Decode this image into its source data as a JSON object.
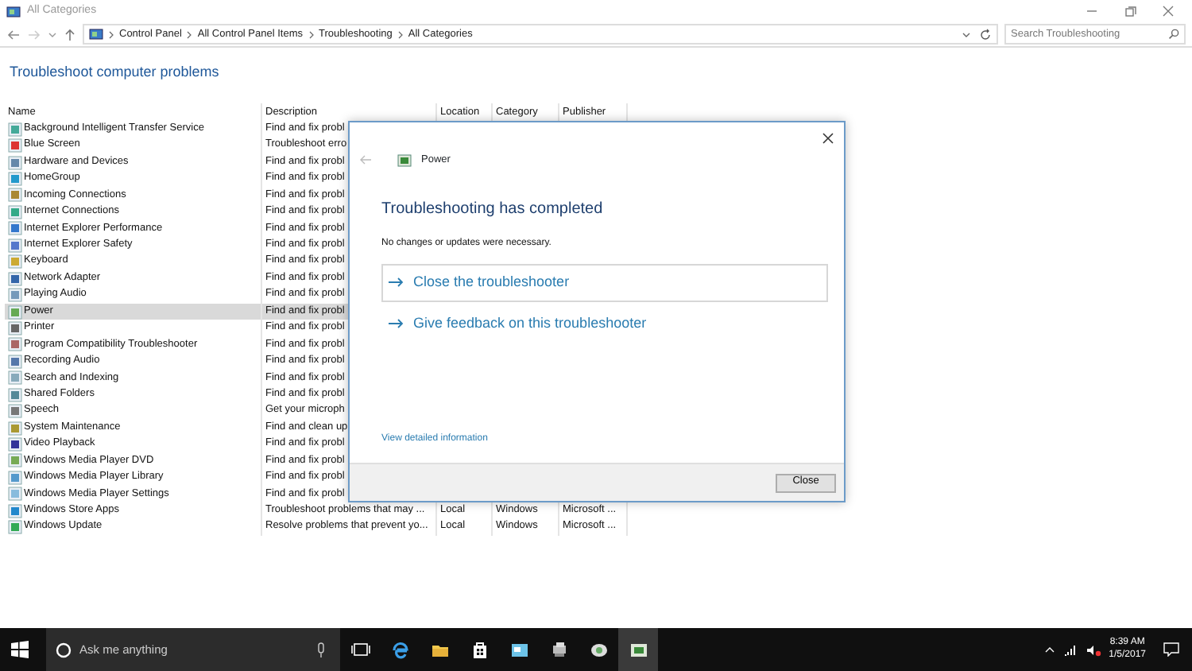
{
  "window": {
    "title": "All Categories"
  },
  "address_bar": {
    "breadcrumbs": [
      "Control Panel",
      "All Control Panel Items",
      "Troubleshooting",
      "All Categories"
    ],
    "search_placeholder": "Search Troubleshooting"
  },
  "heading": "Troubleshoot computer problems",
  "table": {
    "columns": [
      "Name",
      "Description",
      "Location",
      "Category",
      "Publisher"
    ],
    "rows": [
      {
        "name": "Background Intelligent Transfer Service",
        "description": "Find and fix probl",
        "selected": false
      },
      {
        "name": "Blue Screen",
        "description": "Troubleshoot erro",
        "selected": false
      },
      {
        "name": "Hardware and Devices",
        "description": "Find and fix probl",
        "selected": false
      },
      {
        "name": "HomeGroup",
        "description": "Find and fix probl",
        "selected": false
      },
      {
        "name": "Incoming Connections",
        "description": "Find and fix probl",
        "selected": false
      },
      {
        "name": "Internet Connections",
        "description": "Find and fix probl",
        "selected": false
      },
      {
        "name": "Internet Explorer Performance",
        "description": "Find and fix probl",
        "selected": false
      },
      {
        "name": "Internet Explorer Safety",
        "description": "Find and fix probl",
        "selected": false
      },
      {
        "name": "Keyboard",
        "description": "Find and fix probl",
        "selected": false
      },
      {
        "name": "Network Adapter",
        "description": "Find and fix probl",
        "selected": false
      },
      {
        "name": "Playing Audio",
        "description": "Find and fix probl",
        "selected": false
      },
      {
        "name": "Power",
        "description": "Find and fix probl",
        "selected": true
      },
      {
        "name": "Printer",
        "description": "Find and fix probl",
        "selected": false
      },
      {
        "name": "Program Compatibility Troubleshooter",
        "description": "Find and fix probl",
        "selected": false
      },
      {
        "name": "Recording Audio",
        "description": "Find and fix probl",
        "selected": false
      },
      {
        "name": "Search and Indexing",
        "description": "Find and fix probl",
        "selected": false
      },
      {
        "name": "Shared Folders",
        "description": "Find and fix probl",
        "selected": false
      },
      {
        "name": "Speech",
        "description": "Get your microph",
        "selected": false
      },
      {
        "name": "System Maintenance",
        "description": "Find and clean up",
        "selected": false
      },
      {
        "name": "Video Playback",
        "description": "Find and fix probl",
        "selected": false
      },
      {
        "name": "Windows Media Player DVD",
        "description": "Find and fix probl",
        "selected": false
      },
      {
        "name": "Windows Media Player Library",
        "description": "Find and fix probl",
        "selected": false
      },
      {
        "name": "Windows Media Player Settings",
        "description": "Find and fix probl",
        "selected": false
      },
      {
        "name": "Windows Store Apps",
        "description": "Troubleshoot problems that may ...",
        "location": "Local",
        "category": "Windows",
        "publisher": "Microsoft ...",
        "selected": false
      },
      {
        "name": "Windows Update",
        "description": "Resolve problems that prevent yo...",
        "location": "Local",
        "category": "Windows",
        "publisher": "Microsoft ...",
        "selected": false
      }
    ]
  },
  "dialog": {
    "title": "Power",
    "heading": "Troubleshooting has completed",
    "message": "No changes or updates were necessary.",
    "actions": [
      {
        "label": "Close the troubleshooter",
        "boxed": true
      },
      {
        "label": "Give feedback on this troubleshooter",
        "boxed": false
      }
    ],
    "details_link": "View detailed information",
    "button": "Close"
  },
  "taskbar": {
    "search_placeholder": "Ask me anything",
    "time": "8:39 AM",
    "date": "1/5/2017"
  }
}
